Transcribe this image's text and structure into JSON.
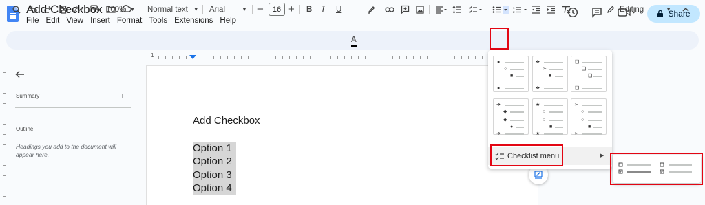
{
  "app": {
    "title": "Add Checkbox",
    "menu": [
      "File",
      "Edit",
      "View",
      "Insert",
      "Format",
      "Tools",
      "Extensions",
      "Help"
    ],
    "share_label": "Share"
  },
  "toolbar": {
    "zoom": "100%",
    "style": "Normal text",
    "font": "Arial",
    "font_size": "16",
    "mode": "Editing",
    "bold": "B",
    "italic": "I",
    "underline": "U",
    "text_color": "A"
  },
  "ruler": {
    "label": "1"
  },
  "side_panel": {
    "summary_label": "Summary",
    "outline_label": "Outline",
    "outline_hint": "Headings you add to the document will appear here."
  },
  "document": {
    "heading": "Add Checkbox",
    "options": [
      "Option 1",
      "Option 2",
      "Option 3",
      "Option 4"
    ]
  },
  "bullet_menu": {
    "checklist_label": "Checklist menu"
  },
  "colors": {
    "accent": "#1a73e8",
    "share_bg": "#c2e7ff",
    "toolbar_bg": "#edf2fa",
    "highlight_box": "#e30613",
    "text_selection": "#d6d6d6"
  }
}
